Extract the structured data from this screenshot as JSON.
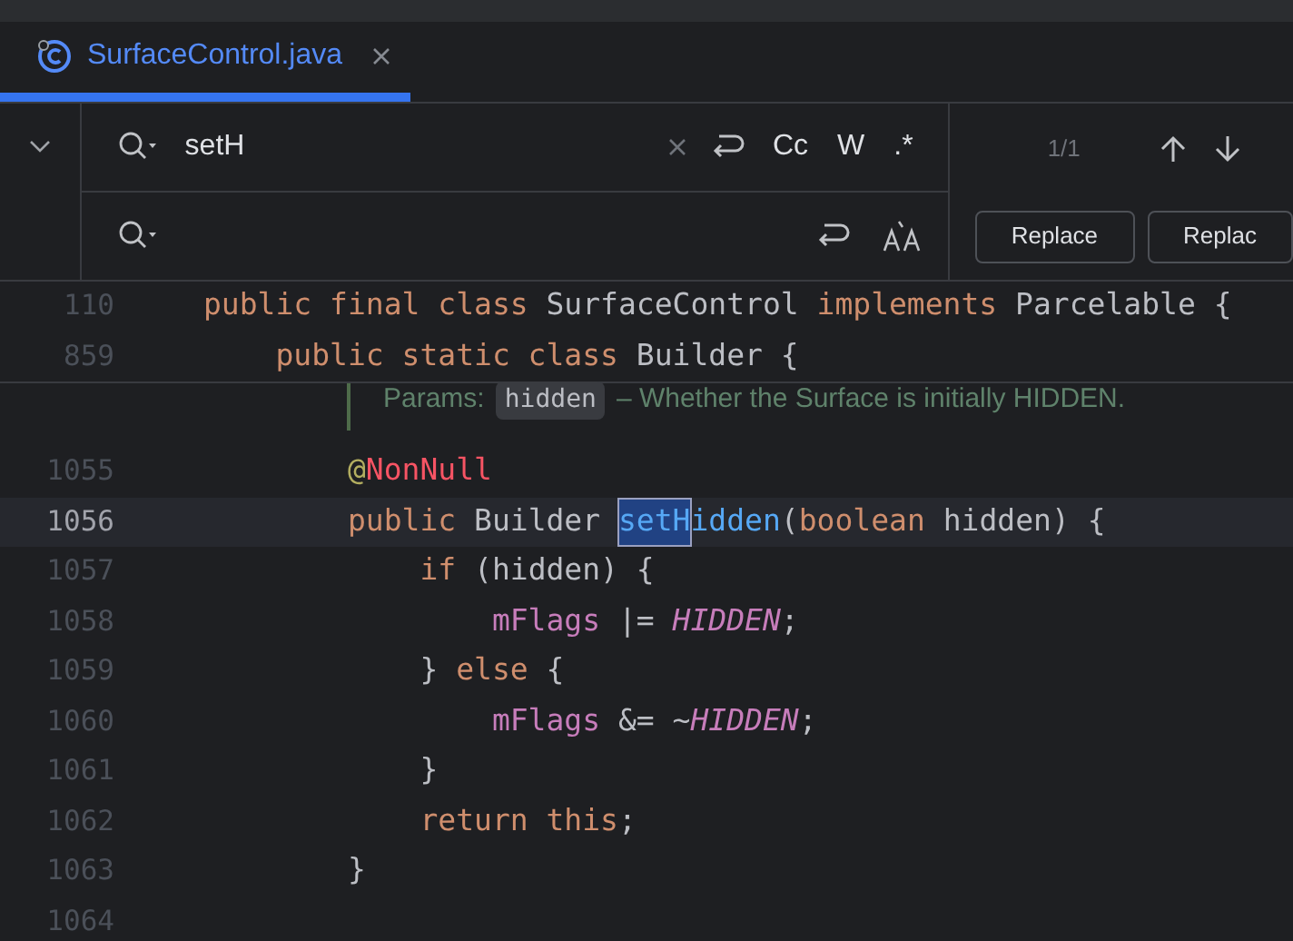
{
  "tab": {
    "label": "SurfaceControl.java",
    "selected": true
  },
  "find": {
    "query": "setH",
    "match_count": "1/1",
    "options": [
      {
        "label": "Cc",
        "on": false
      },
      {
        "label": "W",
        "on": false
      },
      {
        "label": ".*",
        "on": false
      }
    ],
    "replace_buttons": [
      "Replace",
      "Replac"
    ]
  },
  "sticky_lines": [
    {
      "number": "110",
      "tokens": [
        {
          "kind": "kw",
          "text": "public final class "
        },
        {
          "kind": "plain",
          "text": "SurfaceControl "
        },
        {
          "kind": "kw",
          "text": "implements "
        },
        {
          "kind": "plain",
          "text": "Parcelable {"
        }
      ]
    },
    {
      "number": "859",
      "tokens": [
        {
          "kind": "kw",
          "text": "    public static class "
        },
        {
          "kind": "plain",
          "text": "Builder {"
        }
      ]
    }
  ],
  "doc_comment": {
    "label": "Params:",
    "param": "hidden",
    "text": "– Whether the Surface is initially HIDDEN."
  },
  "lines": [
    {
      "number": "1055",
      "current": false,
      "tokens": [
        {
          "kind": "at",
          "text": "        @"
        },
        {
          "kind": "ann",
          "text": "NonNull"
        }
      ]
    },
    {
      "number": "1056",
      "current": true,
      "tokens": [
        {
          "kind": "kw",
          "text": "        public "
        },
        {
          "kind": "plain",
          "text": "Builder "
        },
        {
          "kind": "match",
          "text": "setH"
        },
        {
          "kind": "method",
          "text": "idden"
        },
        {
          "kind": "plain",
          "text": "("
        },
        {
          "kind": "kw",
          "text": "boolean "
        },
        {
          "kind": "plain",
          "text": "hidden) {"
        }
      ]
    },
    {
      "number": "1057",
      "current": false,
      "tokens": [
        {
          "kind": "kw",
          "text": "            if "
        },
        {
          "kind": "plain",
          "text": "(hidden) {"
        }
      ]
    },
    {
      "number": "1058",
      "current": false,
      "tokens": [
        {
          "kind": "field",
          "text": "                mFlags "
        },
        {
          "kind": "plain",
          "text": "|= "
        },
        {
          "kind": "const",
          "text": "HIDDEN"
        },
        {
          "kind": "plain",
          "text": ";"
        }
      ]
    },
    {
      "number": "1059",
      "current": false,
      "tokens": [
        {
          "kind": "plain",
          "text": "            } "
        },
        {
          "kind": "kw",
          "text": "else "
        },
        {
          "kind": "plain",
          "text": "{"
        }
      ]
    },
    {
      "number": "1060",
      "current": false,
      "tokens": [
        {
          "kind": "field",
          "text": "                mFlags "
        },
        {
          "kind": "plain",
          "text": "&= ~"
        },
        {
          "kind": "const",
          "text": "HIDDEN"
        },
        {
          "kind": "plain",
          "text": ";"
        }
      ]
    },
    {
      "number": "1061",
      "current": false,
      "tokens": [
        {
          "kind": "plain",
          "text": "            }"
        }
      ]
    },
    {
      "number": "1062",
      "current": false,
      "tokens": [
        {
          "kind": "kw",
          "text": "            return this"
        },
        {
          "kind": "plain",
          "text": ";"
        }
      ]
    },
    {
      "number": "1063",
      "current": false,
      "tokens": [
        {
          "kind": "plain",
          "text": "        }"
        }
      ]
    },
    {
      "number": "1064",
      "current": false
    }
  ]
}
